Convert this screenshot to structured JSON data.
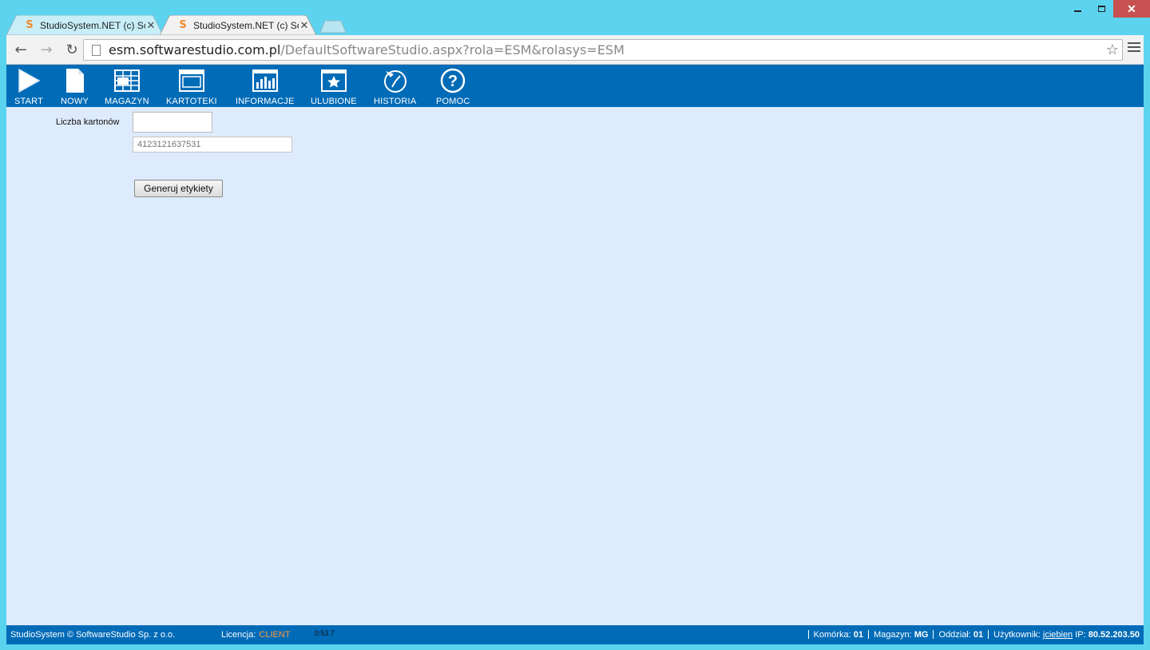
{
  "browser": {
    "tabs": [
      {
        "title": "StudioSystem.NET (c) Soft",
        "active": false
      },
      {
        "title": "StudioSystem.NET (c) Soft",
        "active": true
      }
    ],
    "url_host": "esm.softwarestudio.com.pl",
    "url_path": "/DefaultSoftwareStudio.aspx?rola=ESM&rolasys=ESM",
    "accent": "#5dd4ef"
  },
  "nav": {
    "items": [
      {
        "label": "START",
        "icon": "play-icon"
      },
      {
        "label": "NOWY",
        "icon": "new-document-icon"
      },
      {
        "label": "MAGAZYN",
        "icon": "warehouse-grid-icon"
      },
      {
        "label": "KARTOTEKI",
        "icon": "window-icon"
      },
      {
        "label": "INFORMACJE",
        "icon": "bar-chart-icon"
      },
      {
        "label": "ULUBIONE",
        "icon": "star-icon"
      },
      {
        "label": "HISTORIA",
        "icon": "history-icon"
      },
      {
        "label": "POMOC",
        "icon": "help-icon"
      }
    ],
    "color": "#006bb7"
  },
  "form": {
    "cartons_label": "Liczba kartonów",
    "cartons_value": "",
    "code_placeholder": "4123121637531",
    "generate_label": "Generuj etykiety"
  },
  "footer": {
    "copyright": "StudioSystem © SoftwareStudio Sp. z o.o.",
    "license_label": "Licencja:",
    "license_value": "CLIENT",
    "timer": "0:53.7",
    "komorka_label": "Komórka:",
    "komorka_value": "01",
    "magazyn_label": "Magazyn:",
    "magazyn_value": "MG",
    "oddzial_label": "Oddział:",
    "oddzial_value": "01",
    "user_label": "Użytkownik:",
    "user_value": "jciebien",
    "ip_label": "IP:",
    "ip_value": "80.52.203.50"
  }
}
